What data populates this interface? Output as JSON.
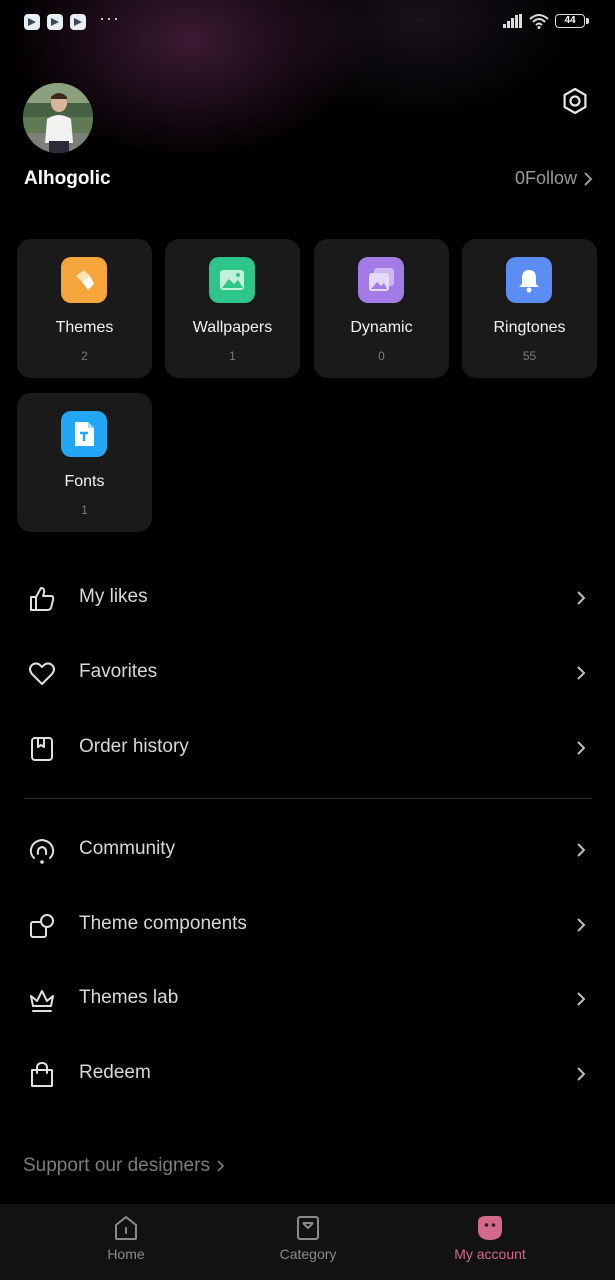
{
  "status_bar": {
    "more": "···",
    "battery": "44"
  },
  "profile": {
    "username": "Alhogolic",
    "follow_label": "0Follow"
  },
  "categories": [
    {
      "label": "Themes",
      "count": "2",
      "icon": "brush-icon",
      "color": "#f6a53a"
    },
    {
      "label": "Wallpapers",
      "count": "1",
      "icon": "image-icon",
      "color": "#2fc48a"
    },
    {
      "label": "Dynamic",
      "count": "0",
      "icon": "layers-icon",
      "color": "#a37be6"
    },
    {
      "label": "Ringtones",
      "count": "55",
      "icon": "bell-icon",
      "color": "#5b8df5"
    },
    {
      "label": "Fonts",
      "count": "1",
      "icon": "font-icon",
      "color": "#22a6f5"
    }
  ],
  "menu_group_1": [
    {
      "label": "My likes",
      "icon": "thumbs-up-icon"
    },
    {
      "label": "Favorites",
      "icon": "heart-icon"
    },
    {
      "label": "Order history",
      "icon": "bookmark-icon"
    }
  ],
  "menu_group_2": [
    {
      "label": "Community",
      "icon": "community-icon"
    },
    {
      "label": "Theme components",
      "icon": "components-icon"
    },
    {
      "label": "Themes lab",
      "icon": "crown-icon"
    },
    {
      "label": "Redeem",
      "icon": "shopping-bag-icon"
    }
  ],
  "support_label": "Support our designers",
  "bottom_nav": [
    {
      "label": "Home",
      "icon": "home-icon"
    },
    {
      "label": "Category",
      "icon": "category-icon"
    },
    {
      "label": "My account",
      "icon": "account-icon",
      "active": true
    }
  ],
  "colors": {
    "accent": "#d36a8a",
    "card_bg": "#1a1a1a",
    "bg": "#000000"
  }
}
